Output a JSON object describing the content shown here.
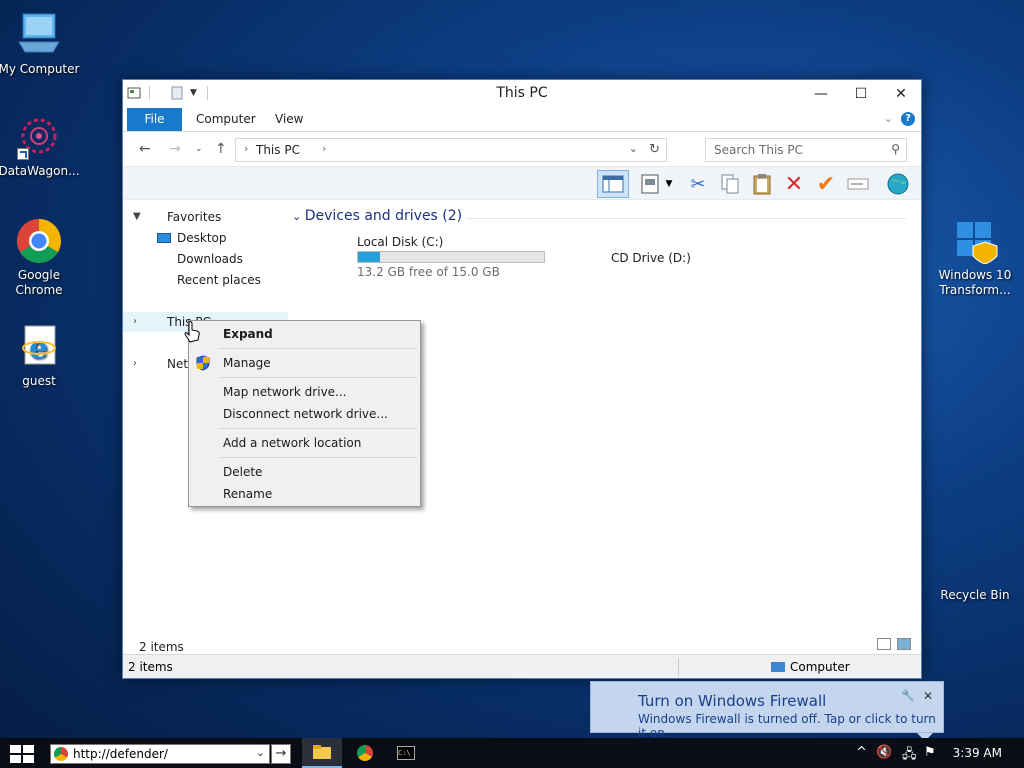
{
  "desktop": {
    "icons": [
      {
        "label": "My Computer"
      },
      {
        "label": "DataWagon..."
      },
      {
        "label": "Google Chrome"
      },
      {
        "label": "guest"
      },
      {
        "label": "Windows 10 Transform..."
      },
      {
        "label": "Recycle Bin"
      }
    ]
  },
  "window": {
    "title": "This PC",
    "tabs": {
      "file": "File",
      "computer": "Computer",
      "view": "View"
    },
    "address": {
      "crumb": "This PC"
    },
    "search": {
      "placeholder": "Search This PC"
    },
    "nav": {
      "favorites": "Favorites",
      "desktop": "Desktop",
      "downloads": "Downloads",
      "recent": "Recent places",
      "thispc": "This PC",
      "network": "Network"
    },
    "content": {
      "group_header": "Devices and drives (2)",
      "drive_c": {
        "name": "Local Disk (C:)",
        "free": "13.2 GB free of 15.0 GB",
        "used_fraction": 0.12
      },
      "drive_d": {
        "name": "CD Drive (D:)"
      }
    },
    "status": {
      "items_inner": "2 items",
      "items": "2 items",
      "location": "Computer"
    }
  },
  "context_menu": {
    "expand": "Expand",
    "manage": "Manage",
    "map": "Map network drive...",
    "disconnect": "Disconnect network drive...",
    "add_location": "Add a network location",
    "delete": "Delete",
    "rename": "Rename"
  },
  "notification": {
    "title": "Turn on Windows Firewall",
    "body": "Windows Firewall is turned off. Tap or click to turn it on."
  },
  "taskbar": {
    "address": "http://defender/",
    "clock": "3:39 AM"
  },
  "colors": {
    "accent": "#1979ca",
    "desktop": "#0d3f86"
  }
}
